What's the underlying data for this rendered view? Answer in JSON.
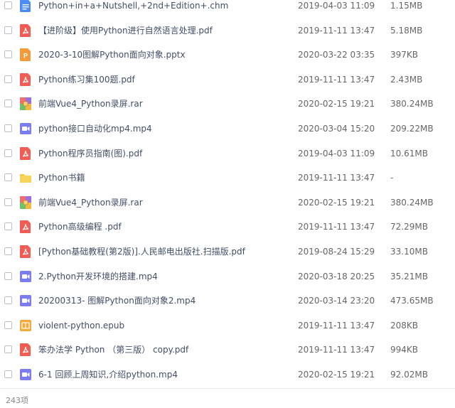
{
  "files": [
    {
      "name": "Python+in+a+Nutshell,+2nd+Edition+.chm",
      "date": "2019-04-03 11:09",
      "size": "1.15MB",
      "icon": "doc-icon",
      "color": "#4d8cf5"
    },
    {
      "name": "【进阶级】使用Python进行自然语言处理.pdf",
      "date": "2019-11-11 13:47",
      "size": "5.18MB",
      "icon": "pdf-icon",
      "color": "#f25c54"
    },
    {
      "name": "2020-3-10图解Python面向对象.pptx",
      "date": "2020-03-22 03:35",
      "size": "397KB",
      "icon": "ppt-icon",
      "color": "#f39a3b"
    },
    {
      "name": "Python练习集100题.pdf",
      "date": "2019-11-11 13:47",
      "size": "2.43MB",
      "icon": "pdf-icon",
      "color": "#f25c54"
    },
    {
      "name": "前端Vue4_Python录屏.rar",
      "date": "2020-02-15 19:21",
      "size": "380.24MB",
      "icon": "rar-icon",
      "color": "#7b68d6"
    },
    {
      "name": "python接口自动化mp4.mp4",
      "date": "2020-03-04 15:20",
      "size": "209.22MB",
      "icon": "video-icon",
      "color": "#7b7cf0"
    },
    {
      "name": "Python程序员指南(图).pdf",
      "date": "2019-04-03 11:09",
      "size": "10.61MB",
      "icon": "pdf-icon",
      "color": "#f25c54"
    },
    {
      "name": "Python书籍",
      "date": "2019-11-11 13:47",
      "size": "-",
      "icon": "folder-icon",
      "color": "#f7c844"
    },
    {
      "name": "前端Vue4_Python录屏.rar",
      "date": "2020-02-15 19:21",
      "size": "380.24MB",
      "icon": "rar-icon",
      "color": "#7b68d6"
    },
    {
      "name": "Python高级编程 .pdf",
      "date": "2019-11-11 13:47",
      "size": "72.29MB",
      "icon": "pdf-icon",
      "color": "#f25c54"
    },
    {
      "name": "[Python基础教程(第2版)].人民邮电出版社.扫描版.pdf",
      "date": "2019-08-24 15:29",
      "size": "33.10MB",
      "icon": "pdf-icon",
      "color": "#f25c54"
    },
    {
      "name": "2.Python开发环境的搭建.mp4",
      "date": "2020-03-18 20:25",
      "size": "35.21MB",
      "icon": "video-icon",
      "color": "#7b7cf0"
    },
    {
      "name": "20200313- 图解Python面向对象2.mp4",
      "date": "2020-03-14 23:20",
      "size": "473.65MB",
      "icon": "video-icon",
      "color": "#7b7cf0"
    },
    {
      "name": "violent-python.epub",
      "date": "2019-11-11 13:47",
      "size": "208KB",
      "icon": "epub-icon",
      "color": "#f5a93b"
    },
    {
      "name": "笨办法学 Python （第三版） copy.pdf",
      "date": "2019-11-11 13:47",
      "size": "994KB",
      "icon": "pdf-icon",
      "color": "#f25c54"
    },
    {
      "name": "6-1 回顾上周知识,介绍python.mp4",
      "date": "2020-02-15 19:21",
      "size": "92.02MB",
      "icon": "video-icon",
      "color": "#7b7cf0"
    }
  ],
  "footer": {
    "count": "243项"
  }
}
